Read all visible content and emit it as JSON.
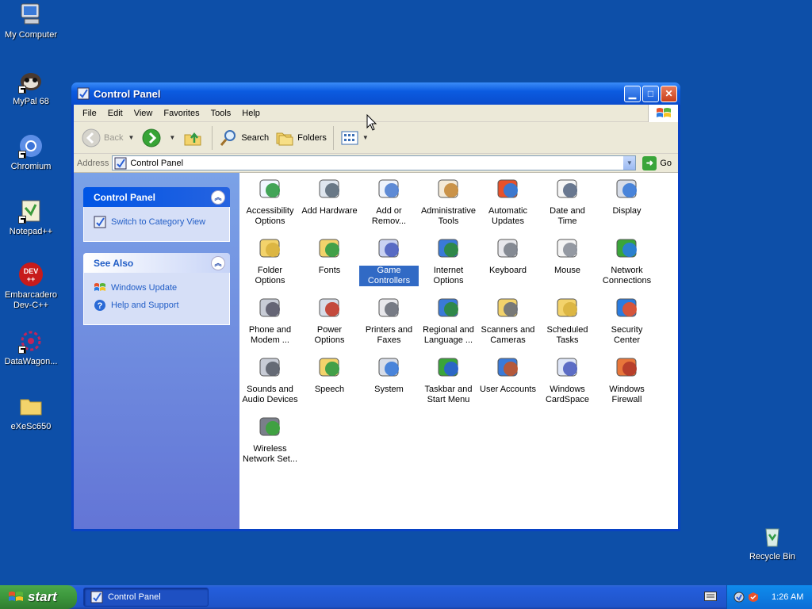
{
  "desktop": {
    "icons": [
      {
        "label": "My Computer",
        "icon": "my-computer-icon"
      },
      {
        "label": "MyPal 68",
        "icon": "mypal-icon"
      },
      {
        "label": "Chromium",
        "icon": "chromium-icon"
      },
      {
        "label": "Notepad++",
        "icon": "notepadpp-icon"
      },
      {
        "label": "Embarcadero Dev-C++",
        "icon": "devcpp-icon"
      },
      {
        "label": "DataWagon...",
        "icon": "datawagon-icon"
      },
      {
        "label": "eXeSc650",
        "icon": "folder-icon"
      },
      {
        "label": "Recycle Bin",
        "icon": "recycle-bin-icon"
      }
    ]
  },
  "window": {
    "title": "Control Panel",
    "menu": [
      "File",
      "Edit",
      "View",
      "Favorites",
      "Tools",
      "Help"
    ],
    "toolbar": {
      "back": "Back",
      "search": "Search",
      "folders": "Folders"
    },
    "address": {
      "label": "Address",
      "value": "Control Panel",
      "go": "Go"
    }
  },
  "taskpane": {
    "control_panel": {
      "title": "Control Panel",
      "link": "Switch to Category View"
    },
    "see_also": {
      "title": "See Also",
      "links": [
        "Windows Update",
        "Help and Support"
      ]
    }
  },
  "items": [
    {
      "label": "Accessibility Options",
      "icon": "accessibility-icon"
    },
    {
      "label": "Add Hardware",
      "icon": "add-hardware-icon"
    },
    {
      "label": "Add or Remov...",
      "icon": "add-remove-programs-icon"
    },
    {
      "label": "Administrative Tools",
      "icon": "admin-tools-icon"
    },
    {
      "label": "Automatic Updates",
      "icon": "automatic-updates-icon"
    },
    {
      "label": "Date and Time",
      "icon": "date-time-icon"
    },
    {
      "label": "Display",
      "icon": "display-icon"
    },
    {
      "label": "Folder Options",
      "icon": "folder-options-icon"
    },
    {
      "label": "Fonts",
      "icon": "fonts-icon"
    },
    {
      "label": "Game Controllers",
      "icon": "game-controllers-icon",
      "selected": true
    },
    {
      "label": "Internet Options",
      "icon": "internet-options-icon"
    },
    {
      "label": "Keyboard",
      "icon": "keyboard-icon"
    },
    {
      "label": "Mouse",
      "icon": "mouse-icon"
    },
    {
      "label": "Network Connections",
      "icon": "network-connections-icon"
    },
    {
      "label": "Phone and Modem ...",
      "icon": "phone-modem-icon"
    },
    {
      "label": "Power Options",
      "icon": "power-options-icon"
    },
    {
      "label": "Printers and Faxes",
      "icon": "printers-faxes-icon"
    },
    {
      "label": "Regional and Language ...",
      "icon": "regional-language-icon"
    },
    {
      "label": "Scanners and Cameras",
      "icon": "scanners-cameras-icon"
    },
    {
      "label": "Scheduled Tasks",
      "icon": "scheduled-tasks-icon"
    },
    {
      "label": "Security Center",
      "icon": "security-center-icon"
    },
    {
      "label": "Sounds and Audio Devices",
      "icon": "sounds-audio-icon"
    },
    {
      "label": "Speech",
      "icon": "speech-icon"
    },
    {
      "label": "System",
      "icon": "system-icon"
    },
    {
      "label": "Taskbar and Start Menu",
      "icon": "taskbar-start-menu-icon"
    },
    {
      "label": "User Accounts",
      "icon": "user-accounts-icon"
    },
    {
      "label": "Windows CardSpace",
      "icon": "cardspace-icon"
    },
    {
      "label": "Windows Firewall",
      "icon": "firewall-icon"
    },
    {
      "label": "Wireless Network Set...",
      "icon": "wireless-network-icon"
    }
  ],
  "taskbar": {
    "start": "start",
    "task": "Control Panel",
    "clock": "1:26 AM"
  },
  "colors": {
    "desktop": "#0d4fa8",
    "titlebar": "#0b5be0",
    "selection": "#316ac5"
  }
}
